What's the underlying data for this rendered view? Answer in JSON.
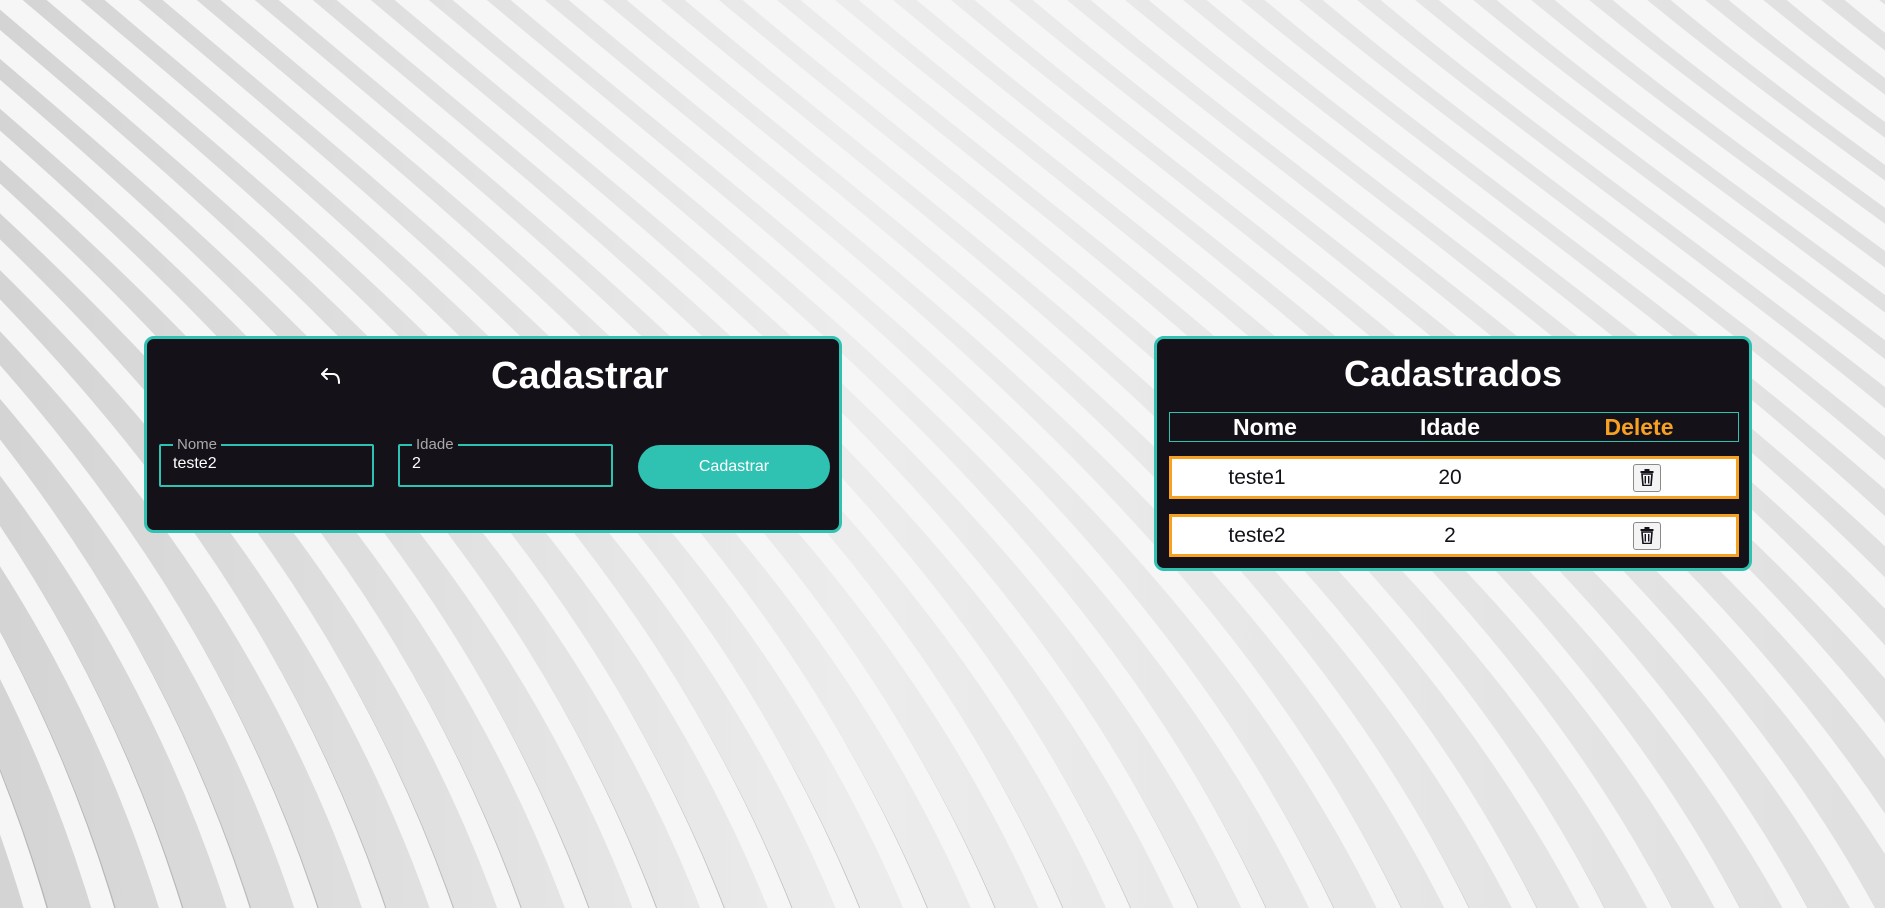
{
  "register": {
    "title": "Cadastrar",
    "back_icon": "undo-arrow-icon",
    "fields": {
      "nome": {
        "label": "Nome",
        "value": "teste2"
      },
      "idade": {
        "label": "Idade",
        "value": "2"
      }
    },
    "submit_label": "Cadastrar"
  },
  "list": {
    "title": "Cadastrados",
    "columns": {
      "nome": "Nome",
      "idade": "Idade",
      "delete": "Delete"
    },
    "rows": [
      {
        "nome": "teste1",
        "idade": "20",
        "delete_icon": "trash-icon"
      },
      {
        "nome": "teste2",
        "idade": "2",
        "delete_icon": "trash-icon"
      }
    ]
  },
  "colors": {
    "accent": "#2fc2b3",
    "card_background": "#141118",
    "delete_highlight": "#f7a123",
    "text": "#ffffff"
  }
}
